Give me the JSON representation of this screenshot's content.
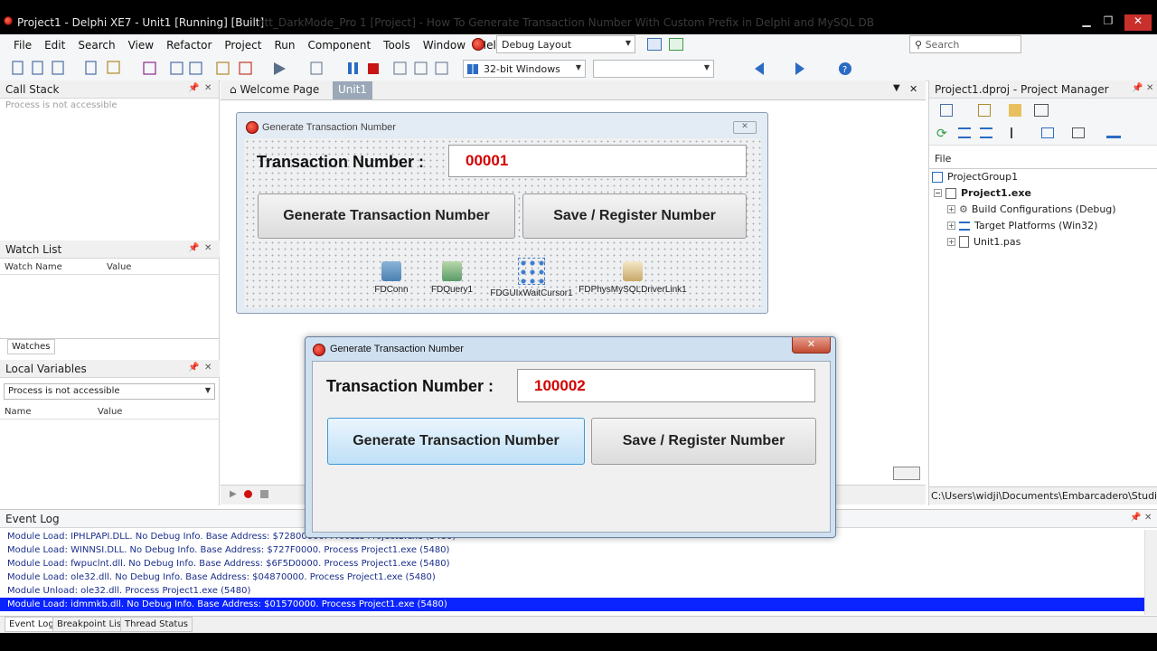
{
  "titlebar": {
    "app": "Project1 - Delphi XE7 - Unit1 [Running] [Built]",
    "ghost": "ntt_DarkMode_Pro 1 [Project] - How To Generate Transaction Number With Custom Prefix in Delphi and MySQL DB"
  },
  "menu": [
    "File",
    "Edit",
    "Search",
    "View",
    "Refactor",
    "Project",
    "Run",
    "Component",
    "Tools",
    "Window",
    "Help"
  ],
  "layout_combo": "Debug Layout",
  "search": {
    "placeholder": "Search"
  },
  "platform_combo": "32-bit Windows",
  "call_stack": {
    "title": "Call Stack",
    "message": "Process is not accessible"
  },
  "watch_list": {
    "title": "Watch List",
    "col1": "Watch Name",
    "col2": "Value",
    "tab": "Watches"
  },
  "local_vars": {
    "title": "Local Variables",
    "combo": "Process is not accessible",
    "col1": "Name",
    "col2": "Value"
  },
  "editor_tabs": {
    "welcome": "Welcome Page",
    "unit": "Unit1"
  },
  "design_form": {
    "title": "Generate Transaction Number",
    "label": "Transaction Number :",
    "value": "00001",
    "btn_generate": "Generate Transaction Number",
    "btn_save": "Save / Register Number",
    "components": [
      "FDConn",
      "FDQuery1",
      "FDGUIxWaitCursor1",
      "FDPhysMySQLDriverLink1"
    ]
  },
  "run_form": {
    "title": "Generate Transaction Number",
    "label": "Transaction Number :",
    "value": "100002",
    "btn_generate": "Generate Transaction Number",
    "btn_save": "Save / Register Number"
  },
  "project_manager": {
    "title": "Project1.dproj - Project Manager",
    "file_label": "File",
    "tree": [
      "ProjectGroup1",
      "Project1.exe",
      "Build Configurations (Debug)",
      "Target Platforms (Win32)",
      "Unit1.pas"
    ],
    "path": "C:\\Users\\widji\\Documents\\Embarcadero\\Studio\\P"
  },
  "event_log": {
    "title": "Event Log",
    "rows": [
      "Module Load: IPHLPAPI.DLL. No Debug Info. Base Address: $72800000. Process Project1.exe (5480)",
      "Module Load: WINNSI.DLL. No Debug Info. Base Address: $727F0000. Process Project1.exe (5480)",
      "Module Load: fwpuclnt.dll. No Debug Info. Base Address: $6F5D0000. Process Project1.exe (5480)",
      "Module Load: ole32.dll. No Debug Info. Base Address: $04870000. Process Project1.exe (5480)",
      "Module Unload: ole32.dll. Process Project1.exe (5480)",
      "Module Load: idmmkb.dll. No Debug Info. Base Address: $01570000. Process Project1.exe (5480)"
    ],
    "selected_index": 5,
    "tabs": [
      "Event Log",
      "Breakpoint List",
      "Thread Status"
    ]
  },
  "colors": {
    "accent_selection": "#0a24ff",
    "value_red": "#d40000",
    "log_text": "#1a2e8a"
  }
}
